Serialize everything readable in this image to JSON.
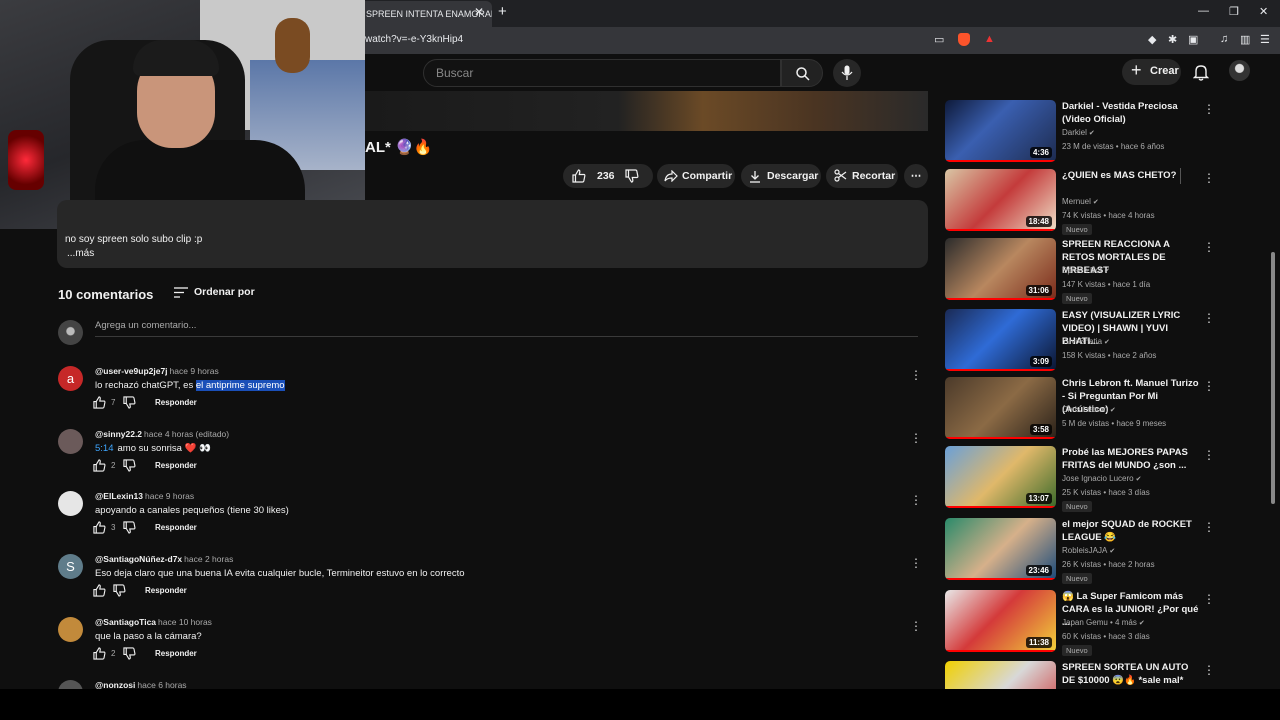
{
  "browser": {
    "tab_title": "SPREEN INTENTA ENAMORAR",
    "url": "watch?v=-e-Y3knHip4",
    "close_glyph": "✕",
    "newtab_glyph": "+",
    "minimize_glyph": "—",
    "restore_glyph": "❐",
    "window_close_glyph": "✕"
  },
  "header": {
    "search_placeholder": "Buscar",
    "create_label": "Crear",
    "create_plus": "+"
  },
  "video": {
    "title_fragment": "AL* 🔮🔥",
    "likes": "236",
    "share_label": "Compartir",
    "download_label": "Descargar",
    "clip_label": "Recortar",
    "more_glyph": "⋯"
  },
  "description": {
    "text": "no soy spreen solo subo clip :p",
    "more": "...más"
  },
  "comments_header": {
    "count": "10 comentarios",
    "sort_label": "Ordenar por",
    "add_placeholder": "Agrega un comentario..."
  },
  "comments": [
    {
      "author": "@user-ve9up2je7j",
      "time": "hace 9 horas",
      "text": "lo rechazó chatGPT, es ",
      "highlight": "el antiprime supremo",
      "likes": "7",
      "reply": "Responder",
      "avatar_letter": "a",
      "avatar_color": "#c62828"
    },
    {
      "author": "@sinny22.2",
      "time": "hace 4 horas (editado)",
      "timestamp": "5:14",
      "text": "amo su sonrisa ❤️ 👀",
      "likes": "2",
      "reply": "Responder",
      "avatar_letter": "",
      "avatar_color": "#6b5a5a"
    },
    {
      "author": "@ElLexin13",
      "time": "hace 9 horas",
      "text": "apoyando a canales pequeños (tiene 30 likes)",
      "likes": "3",
      "reply": "Responder",
      "avatar_letter": "",
      "avatar_color": "#e6e6e6"
    },
    {
      "author": "@SantiagoNúñez-d7x",
      "time": "hace 2 horas",
      "text": "Eso deja claro que una buena IA evita cualquier bucle, Termineitor estuvo en lo correcto",
      "likes": "",
      "reply": "Responder",
      "avatar_letter": "S",
      "avatar_color": "#5f7c8a"
    },
    {
      "author": "@SantiagoTica",
      "time": "hace 10 horas",
      "text": "que la paso a la cámara?",
      "likes": "2",
      "reply": "Responder",
      "avatar_letter": "",
      "avatar_color": "#c28a3b"
    },
    {
      "author": "@nonzosi",
      "time": "hace 6 horas",
      "text": "",
      "likes": "",
      "reply": "",
      "avatar_letter": "",
      "avatar_color": "#555"
    }
  ],
  "sidebar": [
    {
      "title": "Darkiel - Vestida Preciosa (Video Oficial)",
      "channel": "Darkiel",
      "meta": "23 M de vistas • hace 6 años",
      "duration": "4:36",
      "badge": "",
      "thumb": "linear-gradient(135deg,#0e1a3a,#3a5fb0 40%,#1d2b4f)"
    },
    {
      "title": "¿QUIEN es MAS CHETO?",
      "channel": "Mernuel",
      "meta": "74 K vistas • hace 4 horas",
      "duration": "18:48",
      "badge": "Nuevo",
      "thumb": "linear-gradient(135deg,#d9c6a5,#c43b3b 50%,#efe0c8)"
    },
    {
      "title": "SPREEN REACCIONA A RETOS MORTALES DE MRBEAST",
      "channel": "Spreen Bot",
      "meta": "147 K vistas • hace 1 día",
      "duration": "31:06",
      "badge": "Nuevo",
      "thumb": "linear-gradient(135deg,#2b2b2b,#b8875f 50%,#7a2a1a)"
    },
    {
      "title": "EASY (VISUALIZER LYRIC VIDEO) | SHAWN | YUVI BHATI...",
      "channel": "Yuvi Bhatia",
      "meta": "158 K vistas • hace 2 años",
      "duration": "3:09",
      "badge": "",
      "thumb": "linear-gradient(135deg,#1a2a55,#2f6bd6 45%,#0b1530)"
    },
    {
      "title": "Chris Lebron ft. Manuel Turizo - Si Preguntan Por Mi (Acústico)",
      "channel": "Chris Lebron",
      "meta": "5 M de vistas • hace 9 meses",
      "duration": "3:58",
      "badge": "",
      "thumb": "linear-gradient(135deg,#4b3a2a,#8b6a45 50%,#2a2119)"
    },
    {
      "title": "Probé las MEJORES PAPAS FRITAS del MUNDO ¿son ...",
      "channel": "Jose Ignacio Lucero",
      "meta": "25 K vistas • hace 3 días",
      "duration": "13:07",
      "badge": "Nuevo",
      "thumb": "linear-gradient(135deg,#6aa0d8,#e0b86a 50%,#3b6a2a)"
    },
    {
      "title": "el mejor SQUAD de ROCKET LEAGUE 😂",
      "channel": "RobleisJAJA",
      "meta": "26 K vistas • hace 2 horas",
      "duration": "23:46",
      "badge": "Nuevo",
      "thumb": "linear-gradient(135deg,#2a8a6a,#d6b08a 50%,#1a4a7a)"
    },
    {
      "title": "😱 La Super Famicom más CARA es la JUNIOR! ¿Por qué ...",
      "channel": "Japan Gemu • 4 más",
      "meta": "60 K vistas • hace 3 días",
      "duration": "11:38",
      "badge": "Nuevo",
      "thumb": "linear-gradient(135deg,#e8e8e8,#d43a3a 45%,#f2d23a)"
    },
    {
      "title": "SPREEN SORTEA UN AUTO DE $10000 😨🔥 *sale mal*",
      "channel": "",
      "meta": "",
      "duration": "",
      "badge": "",
      "thumb": "linear-gradient(135deg,#f0d000,#d8d8d8 50%,#c33)"
    }
  ],
  "colors": {
    "accent_red": "#ff0000",
    "link_blue": "#3ea6ff",
    "highlight": "#1a4fb8"
  }
}
